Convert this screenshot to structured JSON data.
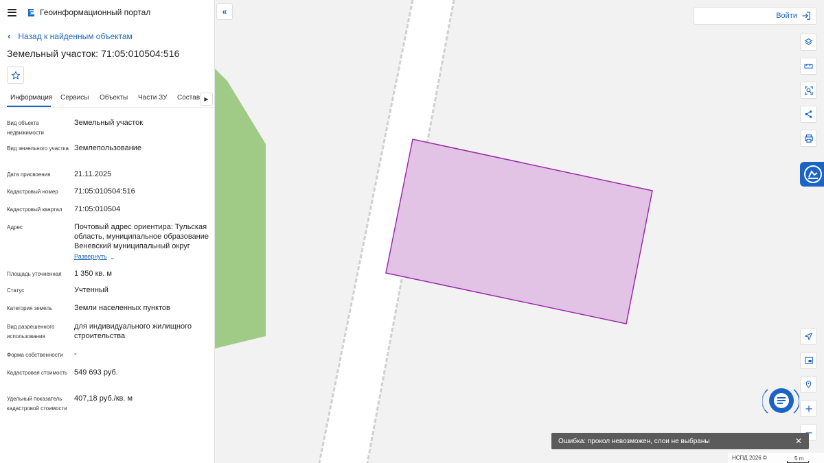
{
  "header": {
    "portal_title": "Геоинформационный портал"
  },
  "back_link": "Назад к найденным объектам",
  "object_title": "Земельный участок: 71:05:010504:516",
  "tabs": [
    "Информация",
    "Сервисы",
    "Объекты",
    "Части ЗУ",
    "Состав"
  ],
  "active_tab": "Информация",
  "properties": [
    {
      "label": "Вид объекта недвижимости",
      "value": "Земельный участок"
    },
    {
      "label": "Вид земельного участка",
      "value": "Землепользование"
    },
    {
      "label": "Дата присвоения",
      "value": "21.11.2025"
    },
    {
      "label": "Кадастровый номер",
      "value": "71:05:010504:516"
    },
    {
      "label": "Кадастровый квартал",
      "value": "71:05:010504"
    },
    {
      "label": "Адрес",
      "value": "Почтовый адрес ориентира: Тульская область, муниципальное образование Веневский муниципальный округ"
    },
    {
      "label": "Площадь уточненная",
      "value": "1 350 кв. м"
    },
    {
      "label": "Статус",
      "value": "Учтенный"
    },
    {
      "label": "Категория земель",
      "value": "Земли населенных пунктов"
    },
    {
      "label": "Вид разрешенного использования",
      "value": "для индивидуального жилищного строительства"
    },
    {
      "label": "Форма собственности",
      "value": "-"
    },
    {
      "label": "Кадастровая стоимость",
      "value": "549 693 руб."
    },
    {
      "label": "Удельный показатель кадастровой стоимости",
      "value": "407,18 руб./кв. м"
    }
  ],
  "expand_link": "Развернуть",
  "login_label": "Войти",
  "toast": {
    "text": "Ошибка: прокол невозможен, слои не выбраны"
  },
  "attribution": "НСПД 2026 ©",
  "scale_label": "5 m",
  "colors": {
    "accent": "#1b64c5",
    "parcel_fill": "#e2c3e6",
    "parcel_stroke": "#9a2ca8",
    "vegetation": "#9fcb86",
    "map_background": "#f2f2f2"
  },
  "icons": {
    "menu": "hamburger-icon",
    "logo": "portal-logo-icon",
    "back": "chevron-left-icon",
    "favorite": "star-icon",
    "collapse": "double-chevron-left-icon",
    "login": "login-icon",
    "tools": [
      "layers-icon",
      "ruler-icon",
      "select-area-icon",
      "share-icon",
      "print-icon",
      "assistant-icon",
      "locate-icon",
      "minimap-icon",
      "geolocation-icon",
      "zoom-in-icon",
      "chat-icon",
      "close-icon"
    ]
  }
}
